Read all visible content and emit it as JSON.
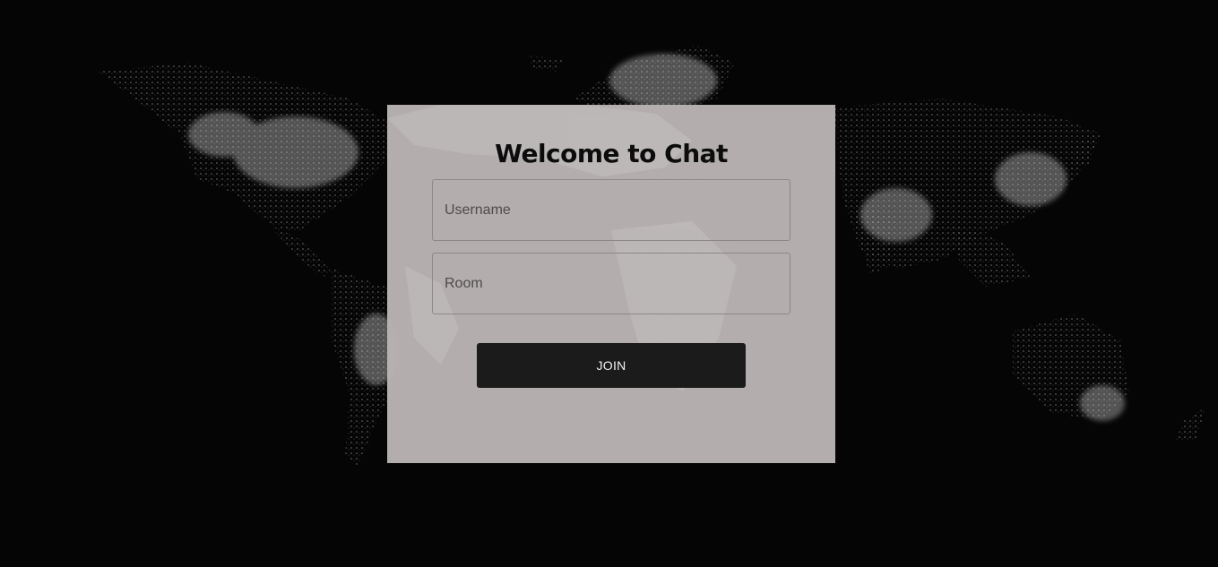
{
  "login": {
    "title": "Welcome to Chat",
    "username_placeholder": "Username",
    "room_placeholder": "Room",
    "join_label": "JOIN"
  },
  "background": {
    "image": "world-map-night-lights"
  },
  "colors": {
    "page_background": "#050505",
    "card_background": "#b9b4b3",
    "button_background": "#1b1b1b",
    "button_text": "#f2f2f2",
    "title_text": "#0c0c0c"
  }
}
